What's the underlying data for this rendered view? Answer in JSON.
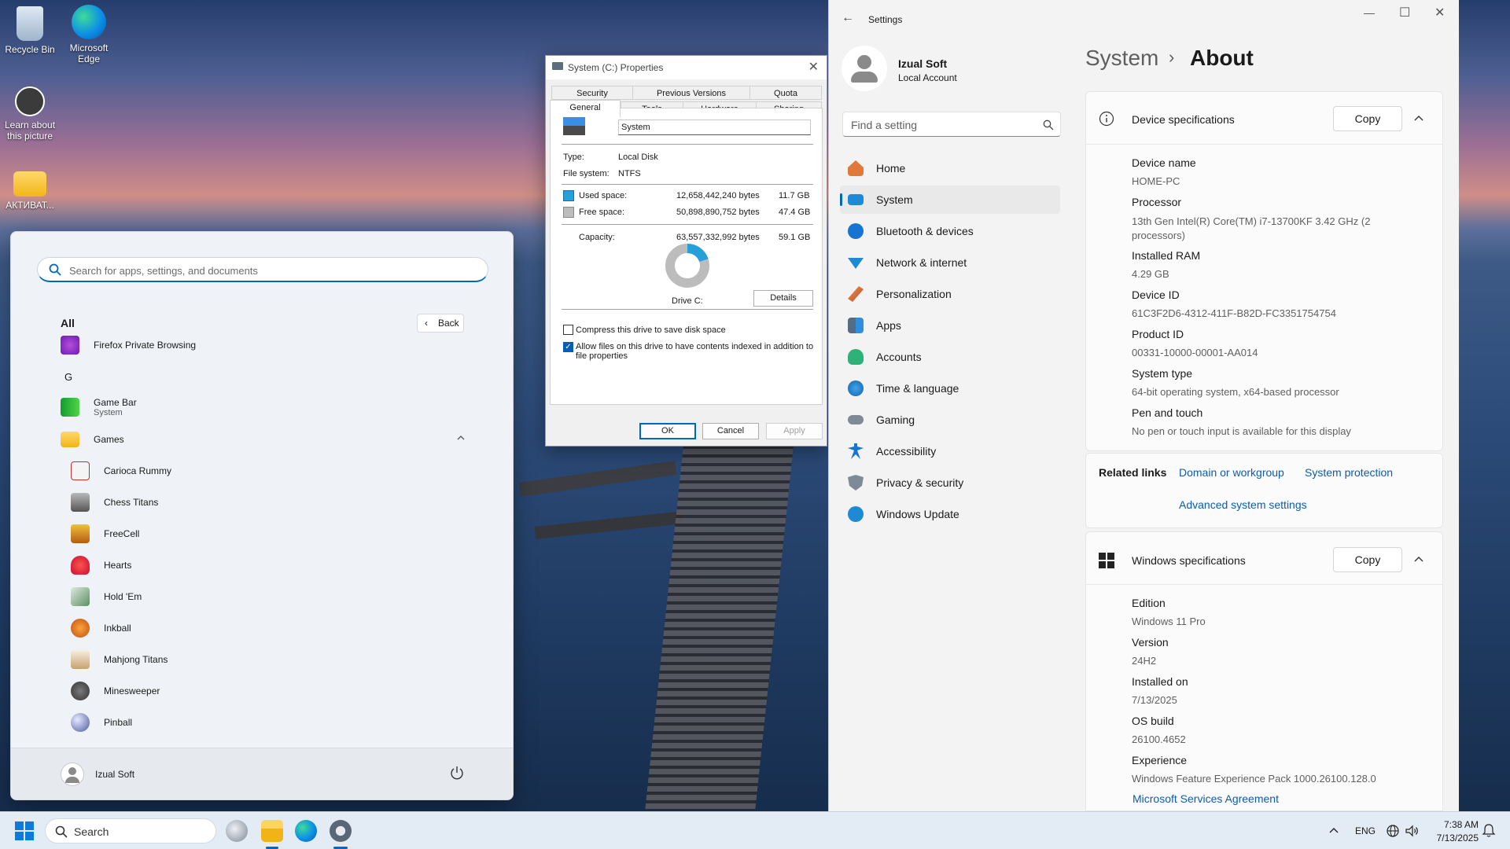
{
  "desktop": {
    "icons": [
      {
        "label": "Recycle Bin"
      },
      {
        "label": "Microsoft Edge"
      },
      {
        "label": "Learn about this picture"
      },
      {
        "label": "АКТИВАТ..."
      }
    ]
  },
  "start": {
    "search_placeholder": "Search for apps, settings, and documents",
    "all_label": "All",
    "back_label": "Back",
    "apps": [
      {
        "label": "Firefox Private Browsing",
        "icon": "firefox-private-icon"
      },
      {
        "label": "G",
        "icon": ""
      },
      {
        "label": "Game Bar",
        "sub": "System",
        "icon": "game-bar-icon"
      },
      {
        "label": "Games",
        "icon": "folder-icon"
      },
      {
        "label": "Carioca Rummy",
        "icon": "cards-icon"
      },
      {
        "label": "Chess Titans",
        "icon": "chess-icon"
      },
      {
        "label": "FreeCell",
        "icon": "freecell-icon"
      },
      {
        "label": "Hearts",
        "icon": "hearts-icon"
      },
      {
        "label": "Hold 'Em",
        "icon": "poker-icon"
      },
      {
        "label": "Inkball",
        "icon": "inkball-icon"
      },
      {
        "label": "Mahjong Titans",
        "icon": "mahjong-icon"
      },
      {
        "label": "Minesweeper",
        "icon": "mine-icon"
      },
      {
        "label": "Pinball",
        "icon": "pinball-icon"
      }
    ],
    "user": "Izual Soft"
  },
  "props": {
    "title": "System (C:) Properties",
    "tabs_row1": [
      "Security",
      "Previous Versions",
      "Quota"
    ],
    "tabs_row2": [
      "General",
      "Tools",
      "Hardware",
      "Sharing"
    ],
    "name_value": "System",
    "type_label": "Type:",
    "type_value": "Local Disk",
    "fs_label": "File system:",
    "fs_value": "NTFS",
    "used_label": "Used space:",
    "used_bytes": "12,658,442,240 bytes",
    "used_gb": "11.7 GB",
    "free_label": "Free space:",
    "free_bytes": "50,898,890,752 bytes",
    "free_gb": "47.4 GB",
    "cap_label": "Capacity:",
    "cap_bytes": "63,557,332,992 bytes",
    "cap_gb": "59.1 GB",
    "drive_label": "Drive C:",
    "details": "Details",
    "compress": "Compress this drive to save disk space",
    "index": "Allow files on this drive to have contents indexed in addition to file properties",
    "ok": "OK",
    "cancel": "Cancel",
    "apply": "Apply",
    "used_fraction": 0.199,
    "colors": {
      "used": "#26a0da",
      "free": "#bcbcbc"
    }
  },
  "settings": {
    "title": "Settings",
    "user": "Izual Soft",
    "account": "Local Account",
    "find_placeholder": "Find a setting",
    "crumb1": "System",
    "crumb2": "About",
    "nav": [
      {
        "label": "Home",
        "icon": "home-icon"
      },
      {
        "label": "System",
        "icon": "system-icon"
      },
      {
        "label": "Bluetooth & devices",
        "icon": "bluetooth-icon"
      },
      {
        "label": "Network & internet",
        "icon": "wifi-icon"
      },
      {
        "label": "Personalization",
        "icon": "brush-icon"
      },
      {
        "label": "Apps",
        "icon": "apps-icon"
      },
      {
        "label": "Accounts",
        "icon": "account-icon"
      },
      {
        "label": "Time & language",
        "icon": "globe-icon"
      },
      {
        "label": "Gaming",
        "icon": "controller-icon"
      },
      {
        "label": "Accessibility",
        "icon": "accessibility-icon"
      },
      {
        "label": "Privacy & security",
        "icon": "shield-icon"
      },
      {
        "label": "Windows Update",
        "icon": "update-icon"
      }
    ],
    "device_specs": {
      "title": "Device specifications",
      "copy": "Copy",
      "rows": [
        {
          "label": "Device name",
          "value": "HOME-PC"
        },
        {
          "label": "Processor",
          "value": "13th Gen Intel(R) Core(TM) i7-13700KF   3.42 GHz  (2 processors)"
        },
        {
          "label": "Installed RAM",
          "value": "4.29 GB"
        },
        {
          "label": "Device ID",
          "value": "61C3F2D6-4312-411F-B82D-FC3351754754"
        },
        {
          "label": "Product ID",
          "value": "00331-10000-00001-AA014"
        },
        {
          "label": "System type",
          "value": "64-bit operating system, x64-based processor"
        },
        {
          "label": "Pen and touch",
          "value": "No pen or touch input is available for this display"
        }
      ]
    },
    "related": {
      "label": "Related links",
      "links": [
        "Domain or workgroup",
        "System protection",
        "Advanced system settings"
      ]
    },
    "win_specs": {
      "title": "Windows specifications",
      "copy": "Copy",
      "rows": [
        {
          "label": "Edition",
          "value": "Windows 11 Pro"
        },
        {
          "label": "Version",
          "value": "24H2"
        },
        {
          "label": "Installed on",
          "value": "7/13/2025"
        },
        {
          "label": "OS build",
          "value": "26100.4652"
        },
        {
          "label": "Experience",
          "value": "Windows Feature Experience Pack 1000.26100.128.0"
        }
      ],
      "msa": "Microsoft Services Agreement"
    }
  },
  "taskbar": {
    "search": "Search",
    "lang": "ENG",
    "time": "7:38 AM",
    "date": "7/13/2025"
  }
}
